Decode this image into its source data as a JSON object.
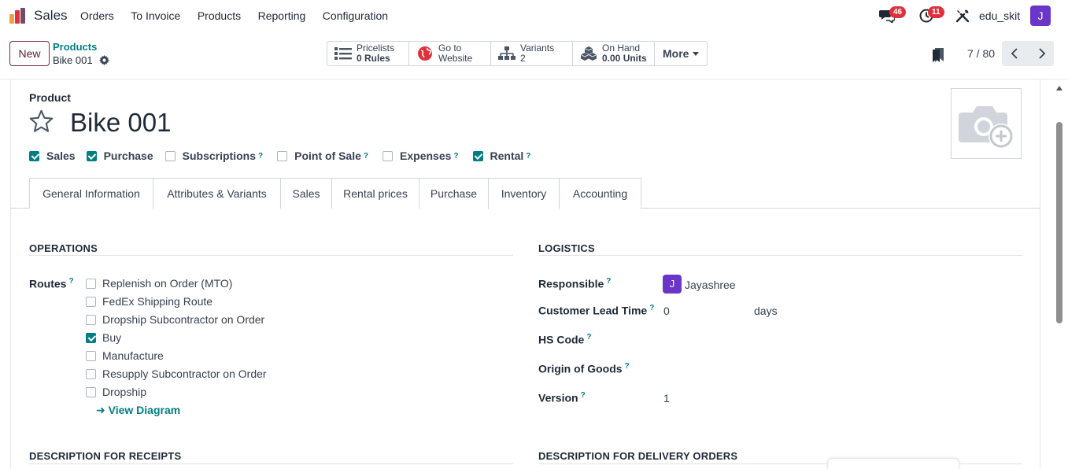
{
  "navbar": {
    "app_name": "Sales",
    "menu": [
      "Orders",
      "To Invoice",
      "Products",
      "Reporting",
      "Configuration"
    ],
    "chat_count": "46",
    "activity_count": "11",
    "user_name": "edu_skit",
    "user_initial": "J",
    "avatar_color": "#6a35c9"
  },
  "control": {
    "new_label": "New",
    "breadcrumb_parent": "Products",
    "breadcrumb_current": "Bike 001",
    "smart_buttons": [
      {
        "line1": "Pricelists",
        "line2": "0  Rules",
        "icon": "list-icon"
      },
      {
        "line1": "Go to",
        "line2": "Website",
        "icon": "globe-icon"
      },
      {
        "line1": "Variants",
        "line2": "2",
        "icon": "sitemap-icon"
      },
      {
        "line1": "On Hand",
        "line2": "0.00 Units",
        "icon": "cubes-icon"
      }
    ],
    "more_label": "More",
    "pager": "7 / 80"
  },
  "form": {
    "product_label": "Product",
    "product_name": "Bike 001",
    "flags": [
      {
        "label": "Sales",
        "checked": true,
        "help": false
      },
      {
        "label": "Purchase",
        "checked": true,
        "help": false
      },
      {
        "label": "Subscriptions",
        "checked": false,
        "help": true
      },
      {
        "label": "Point of Sale",
        "checked": false,
        "help": true
      },
      {
        "label": "Expenses",
        "checked": false,
        "help": true
      },
      {
        "label": "Rental",
        "checked": true,
        "help": true
      }
    ],
    "tabs": [
      "General Information",
      "Attributes & Variants",
      "Sales",
      "Rental prices",
      "Purchase",
      "Inventory",
      "Accounting"
    ],
    "active_tab": "Inventory",
    "help_mark": "?",
    "operations": {
      "title": "OPERATIONS",
      "routes_label": "Routes",
      "routes": [
        {
          "label": "Replenish on Order (MTO)",
          "checked": false
        },
        {
          "label": "FedEx Shipping Route",
          "checked": false
        },
        {
          "label": "Dropship Subcontractor on Order",
          "checked": false
        },
        {
          "label": "Buy",
          "checked": true
        },
        {
          "label": "Manufacture",
          "checked": false
        },
        {
          "label": "Resupply Subcontractor on Order",
          "checked": false
        },
        {
          "label": "Dropship",
          "checked": false
        }
      ],
      "view_diagram": "View Diagram"
    },
    "logistics": {
      "title": "LOGISTICS",
      "responsible_label": "Responsible",
      "responsible_initial": "J",
      "responsible_name": "Jayashree",
      "lead_time_label": "Customer Lead Time",
      "lead_time_value": "0",
      "lead_time_unit": "days",
      "hs_code_label": "HS Code",
      "origin_label": "Origin of Goods",
      "version_label": "Version",
      "version_value": "1"
    },
    "desc_receipts": "DESCRIPTION FOR RECEIPTS",
    "desc_delivery": "DESCRIPTION FOR DELIVERY ORDERS"
  },
  "colors": {
    "brand": "#017e84",
    "new_button": "#7b2d3a",
    "badge": "#e0303c"
  }
}
